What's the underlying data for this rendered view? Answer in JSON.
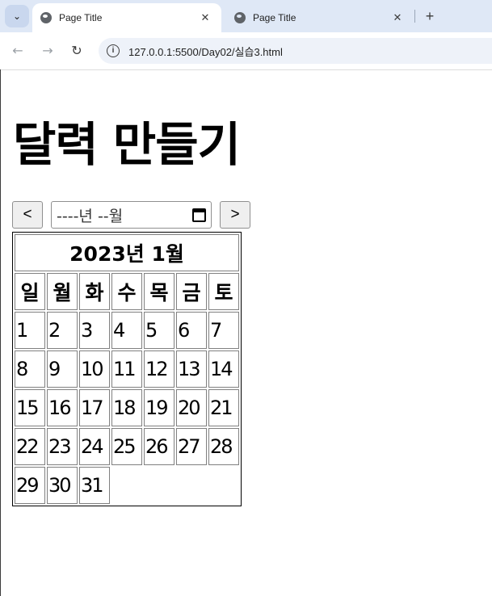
{
  "browser": {
    "tabs": [
      {
        "title": "Page Title",
        "active": true
      },
      {
        "title": "Page Title",
        "active": false
      }
    ],
    "url": "127.0.0.1:5500/Day02/실습3.html",
    "icons": {
      "back": "arrow-left-icon",
      "forward": "arrow-right-icon",
      "reload": "reload-icon",
      "info": "info-icon"
    }
  },
  "page": {
    "heading": "달력 만들기",
    "prev_label": "<",
    "next_label": ">",
    "month_input_placeholder": "----년 --월",
    "calendar": {
      "caption": "2023년 1월",
      "weekdays": [
        "일",
        "월",
        "화",
        "수",
        "목",
        "금",
        "토"
      ],
      "weeks": [
        [
          "1",
          "2",
          "3",
          "4",
          "5",
          "6",
          "7"
        ],
        [
          "8",
          "9",
          "10",
          "11",
          "12",
          "13",
          "14"
        ],
        [
          "15",
          "16",
          "17",
          "18",
          "19",
          "20",
          "21"
        ],
        [
          "22",
          "23",
          "24",
          "25",
          "26",
          "27",
          "28"
        ],
        [
          "29",
          "30",
          "31",
          "",
          "",
          "",
          ""
        ]
      ]
    }
  }
}
